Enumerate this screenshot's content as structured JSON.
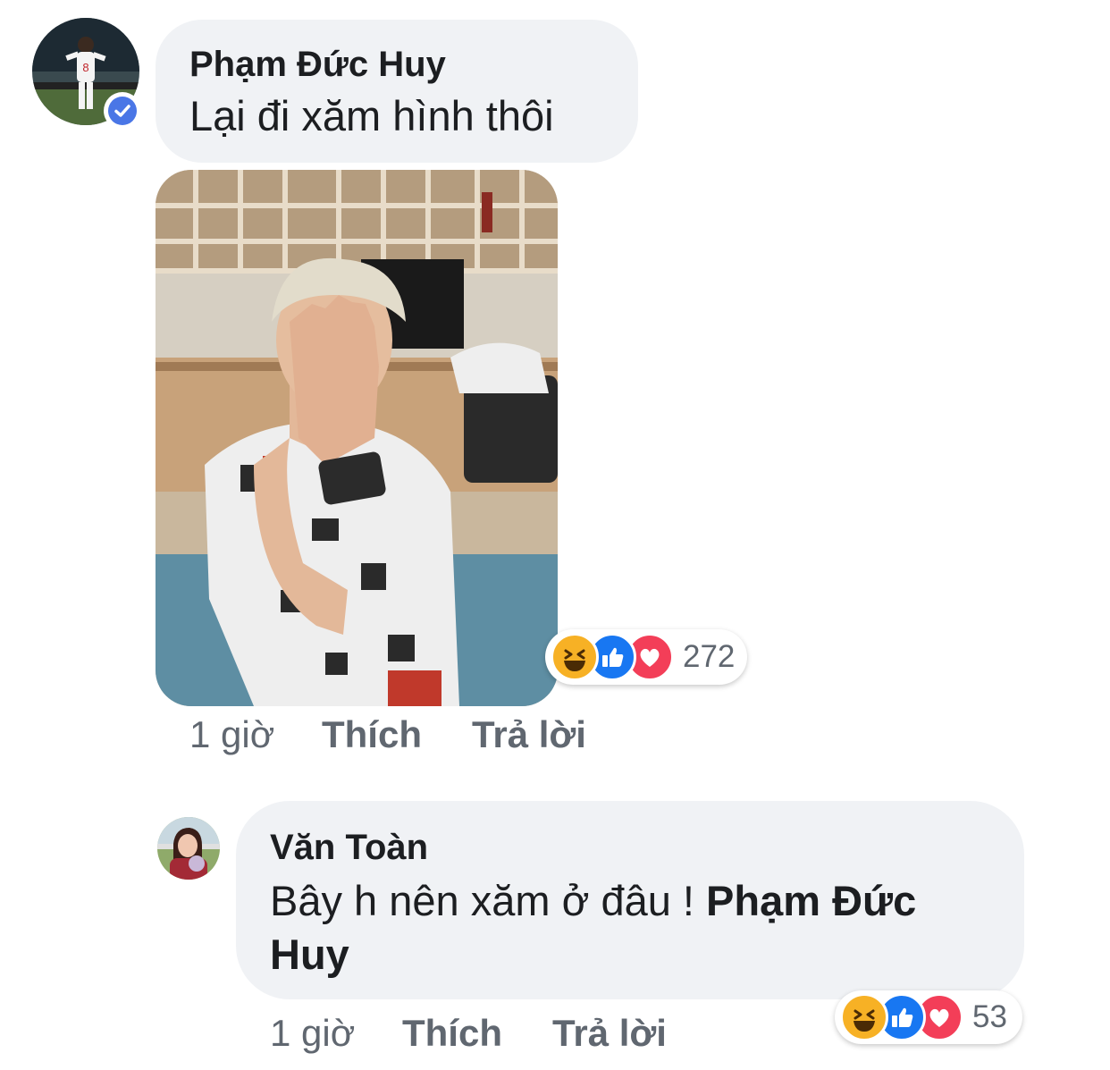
{
  "comment": {
    "author": "Phạm Đức Huy",
    "text": "Lại đi xăm hình thôi",
    "time": "1 giờ",
    "like_label": "Thích",
    "reply_label": "Trả lời",
    "reaction_count": "272",
    "reactions": [
      "haha-icon",
      "like-icon",
      "love-icon"
    ],
    "avatar_jersey_number": "8"
  },
  "reply": {
    "author": "Văn Toàn",
    "text": "Bây h nên xăm ở đâu ! ",
    "mention_line1": "Phạm Đức",
    "mention_line2": "Huy",
    "time": "1 giờ",
    "like_label": "Thích",
    "reply_label": "Trả lời",
    "reaction_count": "53",
    "reactions": [
      "haha-icon",
      "like-icon",
      "love-icon"
    ]
  },
  "colors": {
    "bubble": "#f0f2f5",
    "verified_blue": "#4a76e6",
    "like_blue": "#1877f2",
    "love_red": "#f33e58",
    "haha_yellow": "#f7b125",
    "meta_gray": "#606770"
  }
}
